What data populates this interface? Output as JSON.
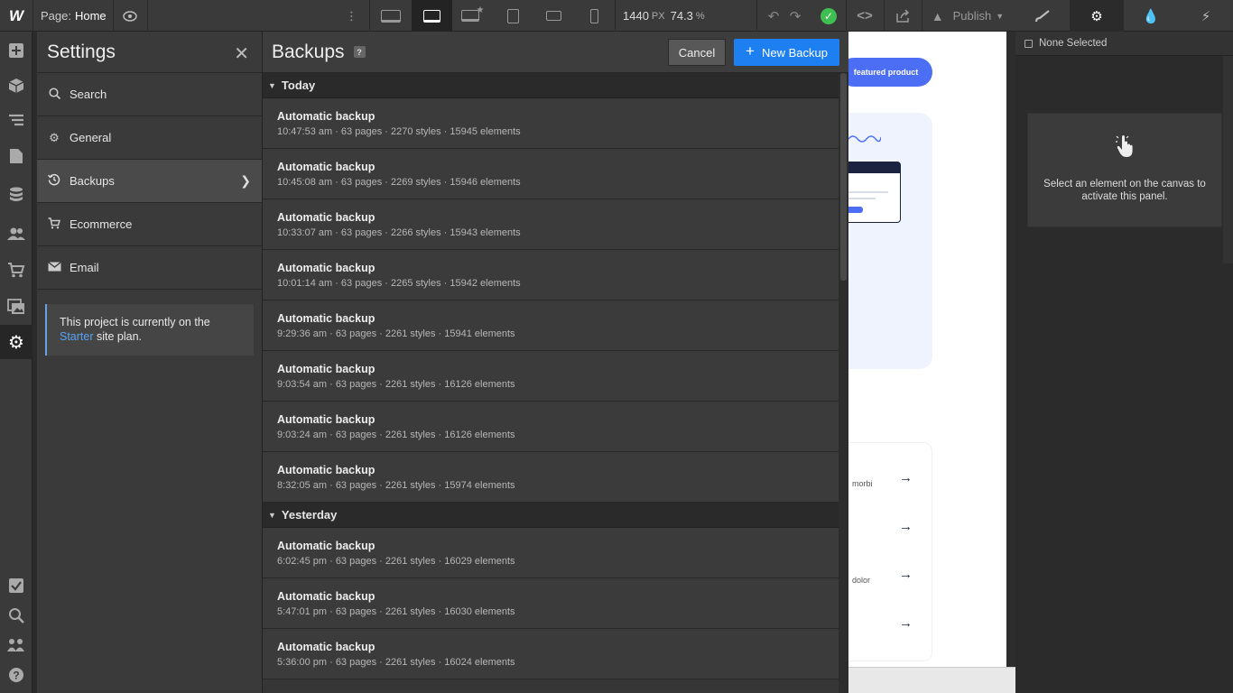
{
  "topbar": {
    "logo": "W",
    "page_label": "Page:",
    "page_name": "Home",
    "width_value": "1440",
    "width_unit": "PX",
    "zoom_value": "74.3",
    "zoom_unit": "%",
    "publish_label": "Publish",
    "devices": [
      "desktop-large-icon",
      "desktop-icon",
      "laptop-star-icon",
      "tablet-icon",
      "mobile-landscape-icon",
      "mobile-portrait-icon"
    ],
    "active_device": "desktop-icon"
  },
  "leftbar": {
    "icons": [
      "add-icon",
      "components-icon",
      "navigator-icon",
      "pages-icon",
      "cms-icon",
      "users-icon",
      "ecommerce-icon",
      "assets-icon",
      "settings-icon",
      "audit-icon",
      "search-icon",
      "collaborators-icon",
      "help-icon"
    ],
    "active": "settings-icon"
  },
  "settings": {
    "title": "Settings",
    "items": [
      {
        "label": "Search",
        "icon": "search-icon"
      },
      {
        "label": "General",
        "icon": "gear-icon"
      },
      {
        "label": "Backups",
        "icon": "history-icon"
      },
      {
        "label": "Ecommerce",
        "icon": "cart-icon"
      },
      {
        "label": "Email",
        "icon": "mail-icon"
      }
    ],
    "plan_text_prefix": "This project is currently on the",
    "plan_link": "Starter",
    "plan_text_suffix": "site plan."
  },
  "backups": {
    "title": "Backups",
    "help": "?",
    "cancel_label": "Cancel",
    "new_label": "New Backup",
    "groups": [
      {
        "label": "Today",
        "rows": [
          {
            "title": "Automatic backup",
            "meta": "10:47:53 am · 63 pages · 2270 styles · 15945 elements"
          },
          {
            "title": "Automatic backup",
            "meta": "10:45:08 am · 63 pages · 2269 styles · 15946 elements"
          },
          {
            "title": "Automatic backup",
            "meta": "10:33:07 am · 63 pages · 2266 styles · 15943 elements"
          },
          {
            "title": "Automatic backup",
            "meta": "10:01:14 am · 63 pages · 2265 styles · 15942 elements"
          },
          {
            "title": "Automatic backup",
            "meta": "9:29:36 am · 63 pages · 2261 styles · 15941 elements"
          },
          {
            "title": "Automatic backup",
            "meta": "9:03:54 am · 63 pages · 2261 styles · 16126 elements"
          },
          {
            "title": "Automatic backup",
            "meta": "9:03:24 am · 63 pages · 2261 styles · 16126 elements"
          },
          {
            "title": "Automatic backup",
            "meta": "8:32:05 am · 63 pages · 2261 styles · 15974 elements"
          }
        ]
      },
      {
        "label": "Yesterday",
        "rows": [
          {
            "title": "Automatic backup",
            "meta": "6:02:45 pm · 63 pages · 2261 styles · 16029 elements"
          },
          {
            "title": "Automatic backup",
            "meta": "5:47:01 pm · 63 pages · 2261 styles · 16030 elements"
          },
          {
            "title": "Automatic backup",
            "meta": "5:36:00 pm · 63 pages · 2261 styles · 16024 elements"
          }
        ]
      }
    ]
  },
  "canvas": {
    "pill_text": "featured product",
    "text_morbi": "morbi",
    "text_dolor": "dolor"
  },
  "rightpanel": {
    "selection": "None Selected",
    "empty_message": "Select an element on the canvas to activate this panel."
  },
  "colors": {
    "accent": "#1d7ff0",
    "success": "#3fbf52",
    "link": "#5aa2f2"
  }
}
